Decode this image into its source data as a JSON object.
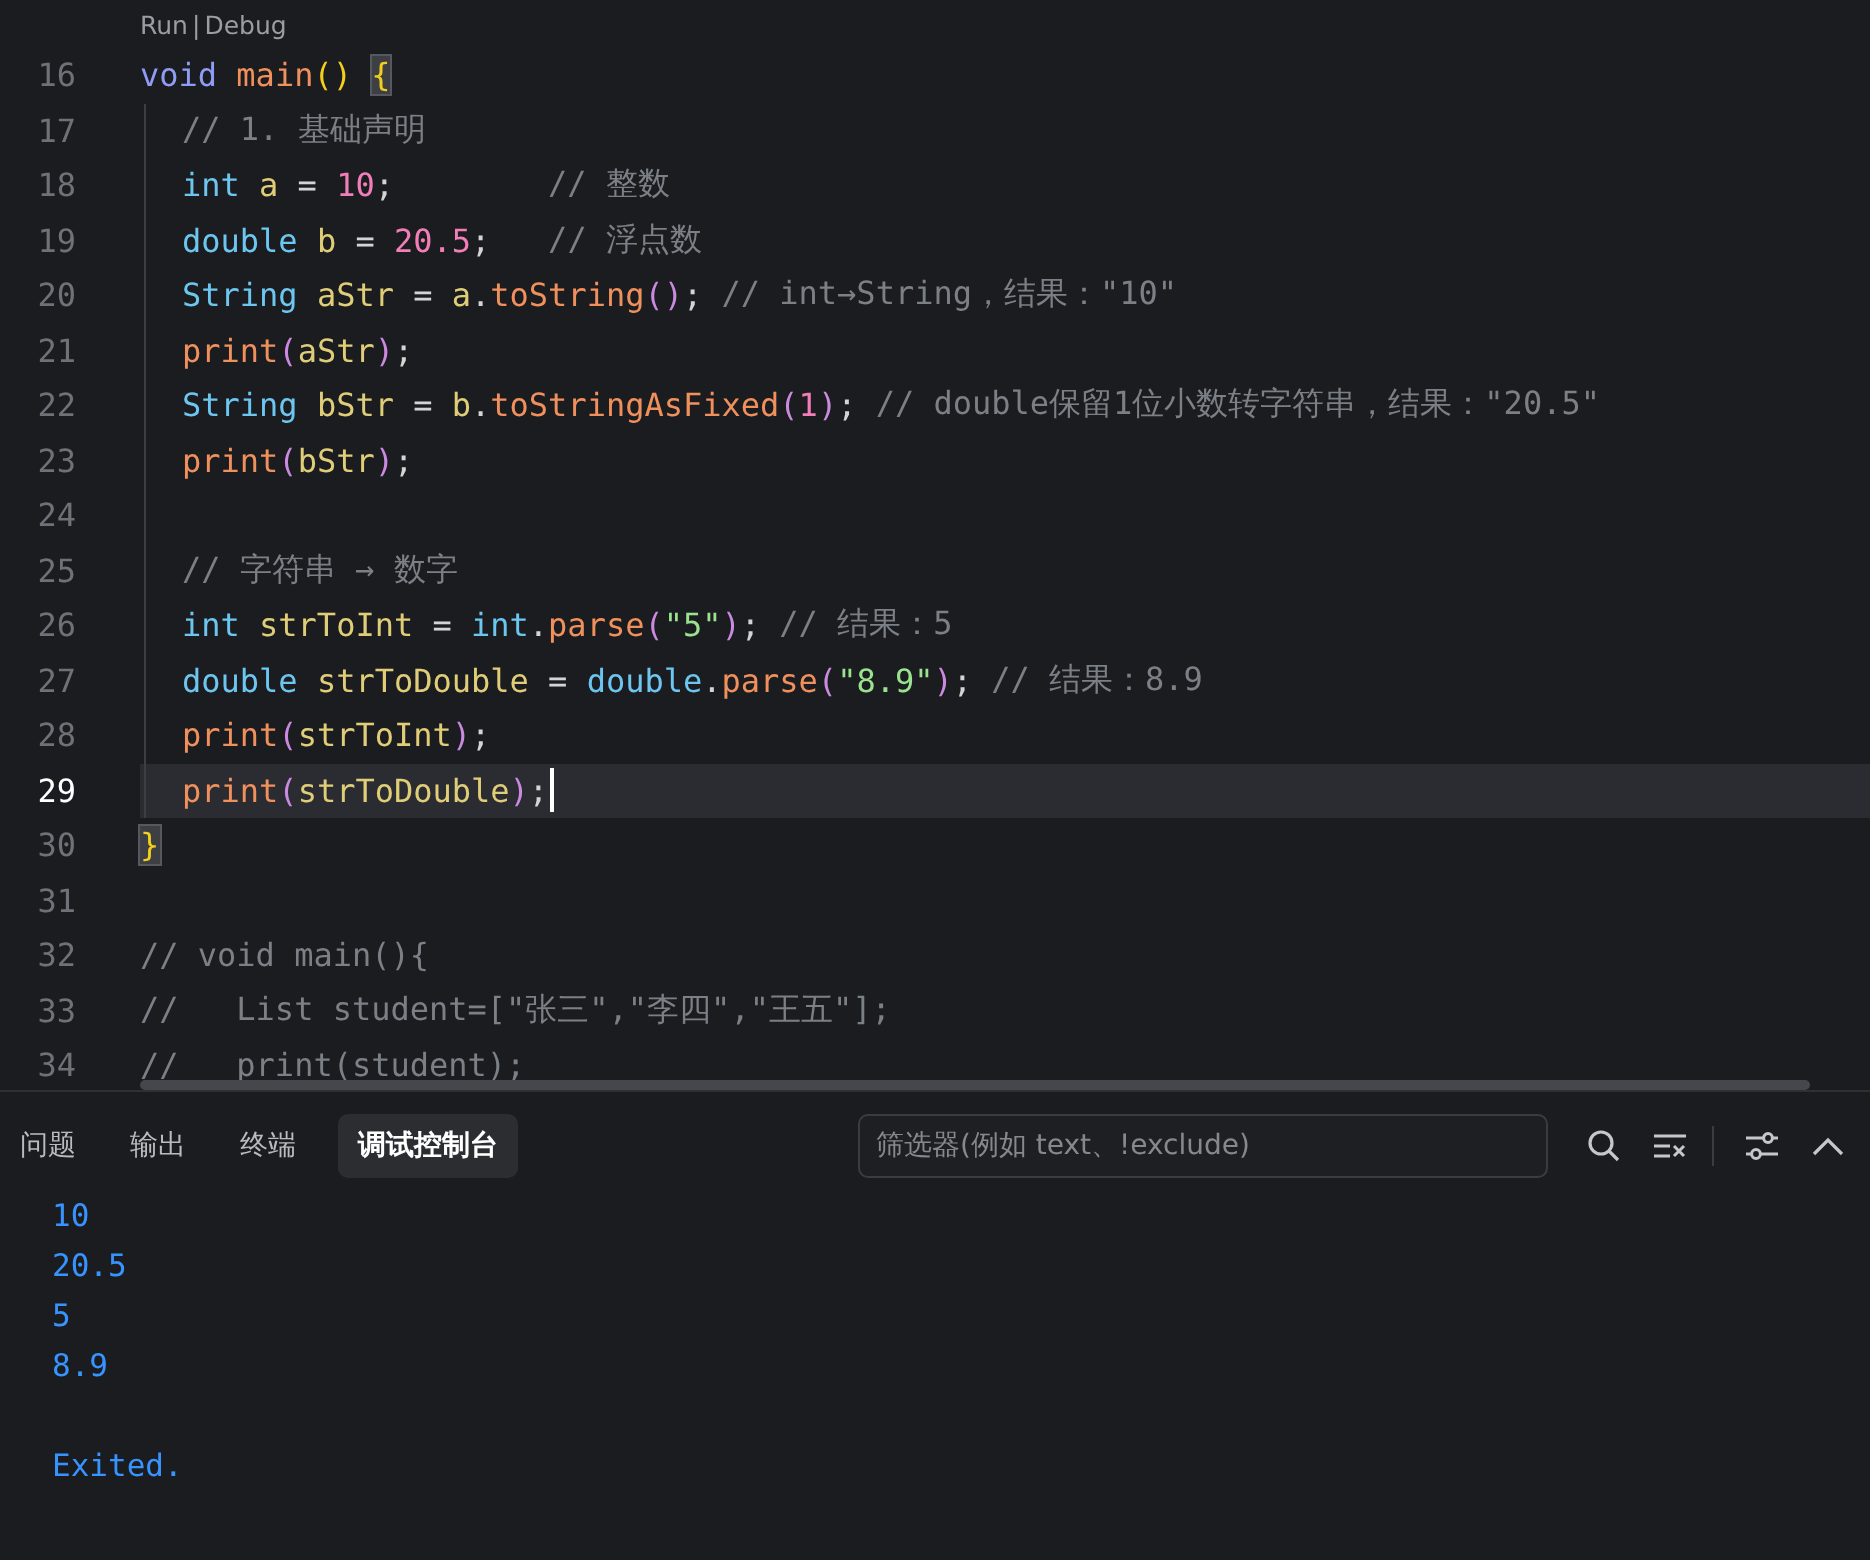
{
  "editor": {
    "lines": [
      {
        "number": "16",
        "current": false,
        "codelens": {
          "actions": [
            "Run",
            "Debug"
          ],
          "separator": "|"
        },
        "tokens": [
          {
            "text": "void ",
            "kind": "keyword"
          },
          {
            "text": "main",
            "kind": "fn"
          },
          {
            "text": "() ",
            "kind": "paren1"
          },
          {
            "text": "{",
            "kind": "matched"
          }
        ],
        "children": [
          {
            "number": "17",
            "current": false,
            "tokens": [
              {
                "text": "// 1. 基础声明",
                "kind": "comment"
              }
            ]
          },
          {
            "number": "18",
            "current": false,
            "tokens": [
              {
                "text": "int ",
                "kind": "type"
              },
              {
                "text": "a",
                "kind": "var"
              },
              {
                "text": " = ",
                "kind": "punct"
              },
              {
                "text": "10",
                "kind": "num"
              },
              {
                "text": ";",
                "kind": "punct"
              },
              {
                "text": "        // 整数",
                "kind": "comment"
              }
            ]
          },
          {
            "number": "19",
            "current": false,
            "tokens": [
              {
                "text": "double ",
                "kind": "type"
              },
              {
                "text": "b",
                "kind": "var"
              },
              {
                "text": " = ",
                "kind": "punct"
              },
              {
                "text": "20.5",
                "kind": "num"
              },
              {
                "text": ";",
                "kind": "punct"
              },
              {
                "text": "   // 浮点数",
                "kind": "comment"
              }
            ]
          },
          {
            "number": "20",
            "current": false,
            "tokens": [
              {
                "text": "String ",
                "kind": "type"
              },
              {
                "text": "aStr",
                "kind": "var"
              },
              {
                "text": " = ",
                "kind": "punct"
              },
              {
                "text": "a",
                "kind": "var"
              },
              {
                "text": ".",
                "kind": "punct"
              },
              {
                "text": "toString",
                "kind": "fn"
              },
              {
                "text": "()",
                "kind": "paren2"
              },
              {
                "text": "; ",
                "kind": "punct"
              },
              {
                "text": "// int→String，结果：\"10\"",
                "kind": "comment"
              }
            ]
          },
          {
            "number": "21",
            "current": false,
            "tokens": [
              {
                "text": "print",
                "kind": "fn"
              },
              {
                "text": "(",
                "kind": "paren2"
              },
              {
                "text": "aStr",
                "kind": "var"
              },
              {
                "text": ")",
                "kind": "paren2"
              },
              {
                "text": ";",
                "kind": "punct"
              }
            ]
          },
          {
            "number": "22",
            "current": false,
            "tokens": [
              {
                "text": "String ",
                "kind": "type"
              },
              {
                "text": "bStr",
                "kind": "var"
              },
              {
                "text": " = ",
                "kind": "punct"
              },
              {
                "text": "b",
                "kind": "var"
              },
              {
                "text": ".",
                "kind": "punct"
              },
              {
                "text": "toStringAsFixed",
                "kind": "fn"
              },
              {
                "text": "(",
                "kind": "paren2"
              },
              {
                "text": "1",
                "kind": "num"
              },
              {
                "text": ")",
                "kind": "paren2"
              },
              {
                "text": "; ",
                "kind": "punct"
              },
              {
                "text": "// double保留1位小数转字符串，结果：\"20.5\"",
                "kind": "comment"
              }
            ]
          },
          {
            "number": "23",
            "current": false,
            "tokens": [
              {
                "text": "print",
                "kind": "fn"
              },
              {
                "text": "(",
                "kind": "paren2"
              },
              {
                "text": "bStr",
                "kind": "var"
              },
              {
                "text": ")",
                "kind": "paren2"
              },
              {
                "text": ";",
                "kind": "punct"
              }
            ]
          },
          {
            "number": "24",
            "current": false
          },
          {
            "number": "25",
            "current": false,
            "tokens": [
              {
                "text": "// 字符串 → 数字",
                "kind": "comment"
              }
            ]
          },
          {
            "number": "26",
            "current": false,
            "tokens": [
              {
                "text": "int ",
                "kind": "type"
              },
              {
                "text": "strToInt",
                "kind": "var"
              },
              {
                "text": " = ",
                "kind": "punct"
              },
              {
                "text": "int",
                "kind": "type"
              },
              {
                "text": ".",
                "kind": "punct"
              },
              {
                "text": "parse",
                "kind": "fn"
              },
              {
                "text": "(",
                "kind": "paren2"
              },
              {
                "text": "\"5\"",
                "kind": "str"
              },
              {
                "text": ")",
                "kind": "paren2"
              },
              {
                "text": "; ",
                "kind": "punct"
              },
              {
                "text": "// 结果：5",
                "kind": "comment"
              }
            ]
          },
          {
            "number": "27",
            "current": false,
            "tokens": [
              {
                "text": "double ",
                "kind": "type"
              },
              {
                "text": "strToDouble",
                "kind": "var"
              },
              {
                "text": " = ",
                "kind": "punct"
              },
              {
                "text": "double",
                "kind": "type"
              },
              {
                "text": ".",
                "kind": "punct"
              },
              {
                "text": "parse",
                "kind": "fn"
              },
              {
                "text": "(",
                "kind": "paren2"
              },
              {
                "text": "\"8.9\"",
                "kind": "str"
              },
              {
                "text": ")",
                "kind": "paren2"
              },
              {
                "text": "; ",
                "kind": "punct"
              },
              {
                "text": "// 结果：8.9",
                "kind": "comment"
              }
            ]
          },
          {
            "number": "28",
            "current": false,
            "tokens": [
              {
                "text": "print",
                "kind": "fn"
              },
              {
                "text": "(",
                "kind": "paren2"
              },
              {
                "text": "strToInt",
                "kind": "var"
              },
              {
                "text": ")",
                "kind": "paren2"
              },
              {
                "text": ";",
                "kind": "punct"
              }
            ]
          },
          {
            "number": "29",
            "current": true,
            "tokens": [
              {
                "text": "print",
                "kind": "fn"
              },
              {
                "text": "(",
                "kind": "paren2"
              },
              {
                "text": "strToDouble",
                "kind": "var"
              },
              {
                "text": ")",
                "kind": "paren2"
              },
              {
                "text": ";",
                "kind": "punct"
              }
            ]
          }
        ]
      },
      {
        "number": "30",
        "current": false,
        "tokens": [
          {
            "text": "}",
            "kind": "matched"
          }
        ]
      },
      {
        "number": "31",
        "current": false
      },
      {
        "number": "32",
        "current": false,
        "tokens": [
          {
            "text": "// void main(){",
            "kind": "comment"
          }
        ]
      },
      {
        "number": "33",
        "current": false,
        "tokens": [
          {
            "text": "//   List student=[\"张三\",\"李四\",\"王五\"];",
            "kind": "comment"
          }
        ]
      },
      {
        "number": "34",
        "current": false,
        "tokens": [
          {
            "text": "//   print(student);",
            "kind": "comment"
          }
        ]
      }
    ]
  },
  "panel": {
    "tabs": [
      {
        "label": "问题",
        "selected": false
      },
      {
        "label": "输出",
        "selected": false
      },
      {
        "label": "终端",
        "selected": false
      },
      {
        "label": "调试控制台",
        "selected": true
      }
    ],
    "filter": {
      "placeholder": "筛选器(例如 text、!exclude)"
    },
    "output": [
      "10",
      "20.5",
      "5",
      "8.9"
    ],
    "exit_message": "Exited."
  }
}
